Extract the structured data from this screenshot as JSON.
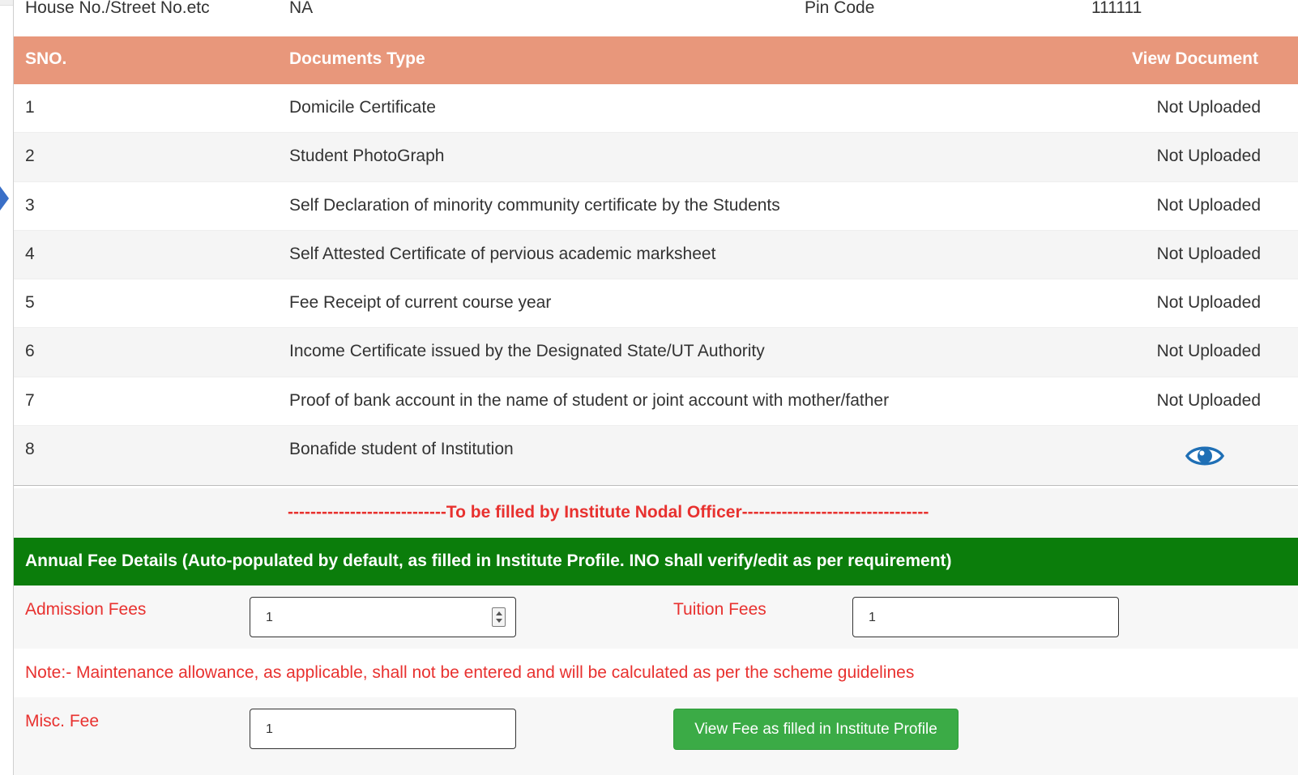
{
  "address": {
    "house_label": "House No./Street No.etc",
    "house_value": "NA",
    "pin_label": "Pin Code",
    "pin_value": "111111"
  },
  "documents": {
    "headers": {
      "sno": "SNO.",
      "type": "Documents Type",
      "view": "View Document"
    },
    "rows": [
      {
        "sno": "1",
        "type": "Domicile Certificate",
        "status": "Not Uploaded"
      },
      {
        "sno": "2",
        "type": "Student PhotoGraph",
        "status": "Not Uploaded"
      },
      {
        "sno": "3",
        "type": "Self Declaration of minority community certificate by the Students",
        "status": "Not Uploaded"
      },
      {
        "sno": "4",
        "type": "Self Attested Certificate of pervious academic marksheet",
        "status": "Not Uploaded"
      },
      {
        "sno": "5",
        "type": "Fee Receipt of current course year",
        "status": "Not Uploaded"
      },
      {
        "sno": "6",
        "type": "Income Certificate issued by the Designated State/UT Authority",
        "status": "Not Uploaded"
      },
      {
        "sno": "7",
        "type": "Proof of bank account in the name of student or joint account with mother/father",
        "status": "Not Uploaded"
      },
      {
        "sno": "8",
        "type": "Bonafide student of Institution",
        "icon": "eye-icon"
      }
    ]
  },
  "divider_text": "----------------------------To be filled by Institute Nodal Officer---------------------------------",
  "fee": {
    "heading": "Annual Fee Details (Auto-populated by default, as filled in Institute Profile. INO shall verify/edit as per requirement)",
    "admission_label": "Admission Fees",
    "admission_value": "1",
    "tuition_label": "Tuition Fees",
    "tuition_value": "1",
    "note": "Note:- Maintenance allowance, as applicable, shall not be entered and will be calculated as per the scheme guidelines",
    "misc_label": "Misc. Fee",
    "misc_value": "1",
    "view_fee_button": "View Fee as filled in Institute Profile"
  },
  "colors": {
    "table_header": "#e8977b",
    "fee_header": "#0b7d0b",
    "label_red": "#e8312f",
    "button_green": "#3bab46",
    "eye_blue": "#1f6fb5"
  }
}
